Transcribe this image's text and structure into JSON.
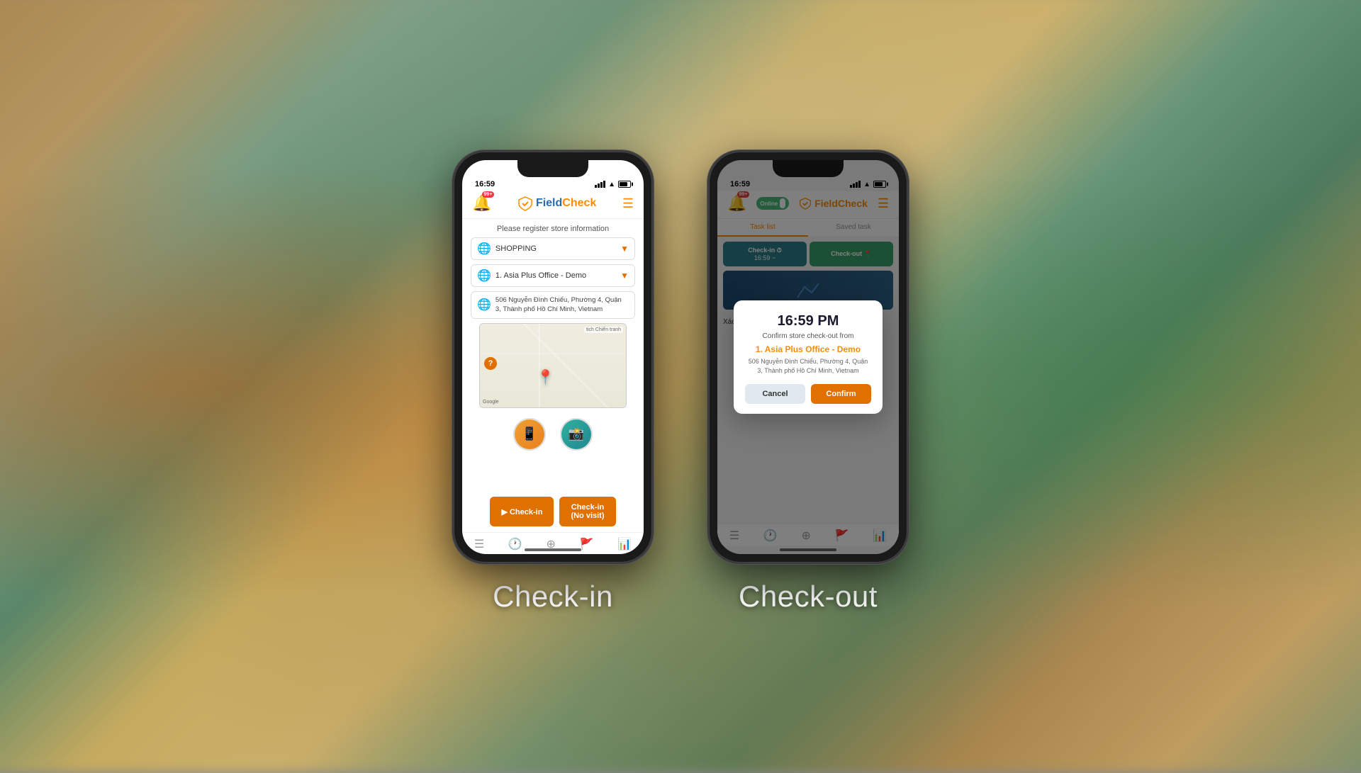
{
  "background": {
    "description": "Blurred supermarket shelves background"
  },
  "labels": {
    "checkin": "Check-in",
    "checkout": "Check-out"
  },
  "checkin_screen": {
    "status_time": "16:59",
    "notification_count": "99+",
    "app_name_field": "Field",
    "app_name_check": "Check",
    "register_text": "Please register store information",
    "category_value": "SHOPPING",
    "store_value": "1. Asia Plus Office - Demo",
    "address_value": "506 Nguyễn Đình Chiểu, Phường 4, Quận 3, Thành phố Hồ Chí Minh, Vietnam",
    "map_label": "tich Chiến tranh",
    "google_label": "Google",
    "btn_checkin": "▶ Check-in",
    "btn_checkin_nv": "Check-in\n(No visit)"
  },
  "checkout_screen": {
    "status_time": "16:59",
    "notification_count": "99+",
    "online_label": "Online",
    "app_name": "FieldCheck",
    "tab_task_list": "Task list",
    "tab_saved_task": "Saved task",
    "checkin_btn": "Check-in ⏱\n16:59 ~",
    "checkout_btn": "Check-out 📍",
    "modal": {
      "time": "16:59 PM",
      "subtitle": "Confirm store check-out from",
      "store_name": "1. Asia Plus Office - Demo",
      "address": "506 Nguyễn Đình Chiểu, Phường 4, Quận 3,\nThành phố Hồ Chí Minh, Vietnam",
      "cancel_label": "Cancel",
      "confirm_label": "Confirm"
    },
    "section_title": "Xác nhận quầy trưng bày"
  }
}
